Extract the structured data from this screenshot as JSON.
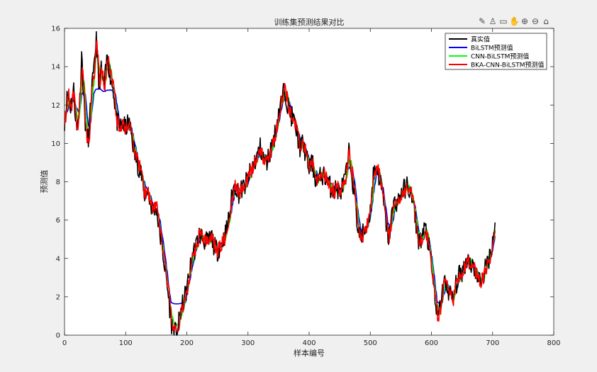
{
  "toolbar": {
    "icons": [
      "brush-icon",
      "data-tip-icon",
      "zoom-region-icon",
      "pan-icon",
      "zoom-in-icon",
      "zoom-out-icon",
      "home-icon"
    ],
    "glyphs": [
      "✎",
      "♙",
      "▭",
      "✋",
      "⊕",
      "⊖",
      "⌂"
    ]
  },
  "colors": {
    "figure_bg": "#f0f0f0",
    "axes_bg": "#ffffff",
    "axis": "#262626",
    "true_series": "#000000",
    "bilstm": "#0000ff",
    "cnn_bilstm": "#00ff00",
    "bka_cnn_bilstm": "#ff0000"
  },
  "chart_data": {
    "type": "line",
    "title": "训练集预测结果对比",
    "xlabel": "样本编号",
    "ylabel": "预测值",
    "xlim": [
      0,
      800
    ],
    "ylim": [
      0,
      16
    ],
    "xticks": [
      0,
      100,
      200,
      300,
      400,
      500,
      600,
      700,
      800
    ],
    "yticks": [
      0,
      2,
      4,
      6,
      8,
      10,
      12,
      14,
      16
    ],
    "grid": false,
    "legend_position": "top-right",
    "x_count": 705,
    "anchors_true": [
      [
        0,
        11.2
      ],
      [
        5,
        12.6
      ],
      [
        10,
        11.9
      ],
      [
        15,
        12.8
      ],
      [
        20,
        10.6
      ],
      [
        25,
        12.3
      ],
      [
        28,
        14.7
      ],
      [
        32,
        12.0
      ],
      [
        36,
        10.2
      ],
      [
        40,
        10.4
      ],
      [
        44,
        12.8
      ],
      [
        48,
        13.6
      ],
      [
        52,
        15.7
      ],
      [
        56,
        13.0
      ],
      [
        60,
        13.8
      ],
      [
        65,
        12.9
      ],
      [
        70,
        14.6
      ],
      [
        75,
        13.5
      ],
      [
        80,
        12.8
      ],
      [
        85,
        11.2
      ],
      [
        90,
        10.8
      ],
      [
        95,
        11.0
      ],
      [
        100,
        10.8
      ],
      [
        105,
        11.1
      ],
      [
        110,
        10.4
      ],
      [
        115,
        9.4
      ],
      [
        120,
        8.9
      ],
      [
        125,
        8.5
      ],
      [
        130,
        7.3
      ],
      [
        135,
        7.6
      ],
      [
        140,
        6.9
      ],
      [
        145,
        6.5
      ],
      [
        150,
        6.7
      ],
      [
        155,
        5.5
      ],
      [
        160,
        4.5
      ],
      [
        165,
        3.3
      ],
      [
        170,
        2.0
      ],
      [
        175,
        0.6
      ],
      [
        180,
        0.1
      ],
      [
        185,
        0.3
      ],
      [
        190,
        1.2
      ],
      [
        195,
        1.8
      ],
      [
        200,
        2.4
      ],
      [
        205,
        3.4
      ],
      [
        210,
        4.3
      ],
      [
        215,
        4.6
      ],
      [
        220,
        5.3
      ],
      [
        225,
        5.1
      ],
      [
        230,
        4.9
      ],
      [
        235,
        4.8
      ],
      [
        240,
        5.2
      ],
      [
        245,
        4.6
      ],
      [
        250,
        4.4
      ],
      [
        255,
        4.7
      ],
      [
        260,
        5.0
      ],
      [
        265,
        5.5
      ],
      [
        270,
        6.3
      ],
      [
        275,
        7.6
      ],
      [
        280,
        7.8
      ],
      [
        285,
        7.4
      ],
      [
        290,
        7.6
      ],
      [
        295,
        7.8
      ],
      [
        300,
        8.2
      ],
      [
        305,
        8.6
      ],
      [
        310,
        9.0
      ],
      [
        315,
        9.3
      ],
      [
        320,
        9.8
      ],
      [
        325,
        9.2
      ],
      [
        330,
        9.0
      ],
      [
        335,
        9.4
      ],
      [
        340,
        10.0
      ],
      [
        345,
        10.6
      ],
      [
        350,
        11.6
      ],
      [
        355,
        12.2
      ],
      [
        360,
        12.9
      ],
      [
        365,
        12.0
      ],
      [
        370,
        11.5
      ],
      [
        375,
        11.2
      ],
      [
        380,
        10.5
      ],
      [
        385,
        9.8
      ],
      [
        390,
        10.0
      ],
      [
        395,
        9.3
      ],
      [
        400,
        8.7
      ],
      [
        405,
        9.0
      ],
      [
        410,
        8.2
      ],
      [
        415,
        8.0
      ],
      [
        420,
        8.4
      ],
      [
        425,
        8.3
      ],
      [
        430,
        8.1
      ],
      [
        435,
        7.7
      ],
      [
        440,
        7.5
      ],
      [
        445,
        7.7
      ],
      [
        450,
        7.4
      ],
      [
        455,
        7.8
      ],
      [
        460,
        8.3
      ],
      [
        465,
        9.5
      ],
      [
        470,
        8.4
      ],
      [
        475,
        7.0
      ],
      [
        480,
        5.5
      ],
      [
        485,
        5.0
      ],
      [
        490,
        5.5
      ],
      [
        495,
        5.8
      ],
      [
        500,
        6.5
      ],
      [
        505,
        8.4
      ],
      [
        510,
        8.8
      ],
      [
        515,
        8.2
      ],
      [
        520,
        7.3
      ],
      [
        525,
        6.0
      ],
      [
        530,
        5.0
      ],
      [
        535,
        6.2
      ],
      [
        540,
        7.0
      ],
      [
        545,
        6.9
      ],
      [
        550,
        7.4
      ],
      [
        555,
        7.6
      ],
      [
        560,
        7.8
      ],
      [
        565,
        7.5
      ],
      [
        570,
        6.8
      ],
      [
        575,
        5.8
      ],
      [
        580,
        4.8
      ],
      [
        585,
        5.2
      ],
      [
        590,
        5.6
      ],
      [
        595,
        4.8
      ],
      [
        600,
        3.5
      ],
      [
        605,
        2.2
      ],
      [
        610,
        0.8
      ],
      [
        615,
        1.6
      ],
      [
        620,
        2.8
      ],
      [
        625,
        2.5
      ],
      [
        630,
        2.2
      ],
      [
        635,
        1.8
      ],
      [
        640,
        2.6
      ],
      [
        645,
        3.1
      ],
      [
        650,
        3.3
      ],
      [
        655,
        3.7
      ],
      [
        660,
        4.0
      ],
      [
        665,
        3.7
      ],
      [
        670,
        3.5
      ],
      [
        675,
        3.0
      ],
      [
        680,
        2.8
      ],
      [
        685,
        3.1
      ],
      [
        690,
        3.7
      ],
      [
        695,
        4.1
      ],
      [
        700,
        4.9
      ],
      [
        704,
        5.9
      ]
    ],
    "series": [
      {
        "name": "真实值",
        "color": "#000000",
        "lag": 0,
        "smooth": 0,
        "noise": 0.55,
        "cap_low": null,
        "cap_high": null,
        "seed": 11
      },
      {
        "name": "BiLSTM预测值",
        "color": "#0000ff",
        "lag": 3,
        "smooth": 5,
        "noise": 0.12,
        "cap_low": 1.7,
        "cap_high": 12.6,
        "seed": 23
      },
      {
        "name": "CNN-BiLSTM预测值",
        "color": "#00ff00",
        "lag": 2,
        "smooth": 3,
        "noise": 0.2,
        "cap_low": 0.55,
        "cap_high": null,
        "seed": 37
      },
      {
        "name": "BKA-CNN-BiLSTM预测值",
        "color": "#ff0000",
        "lag": 1,
        "smooth": 1,
        "noise": 0.4,
        "cap_low": 0.25,
        "cap_high": null,
        "seed": 53
      }
    ]
  }
}
